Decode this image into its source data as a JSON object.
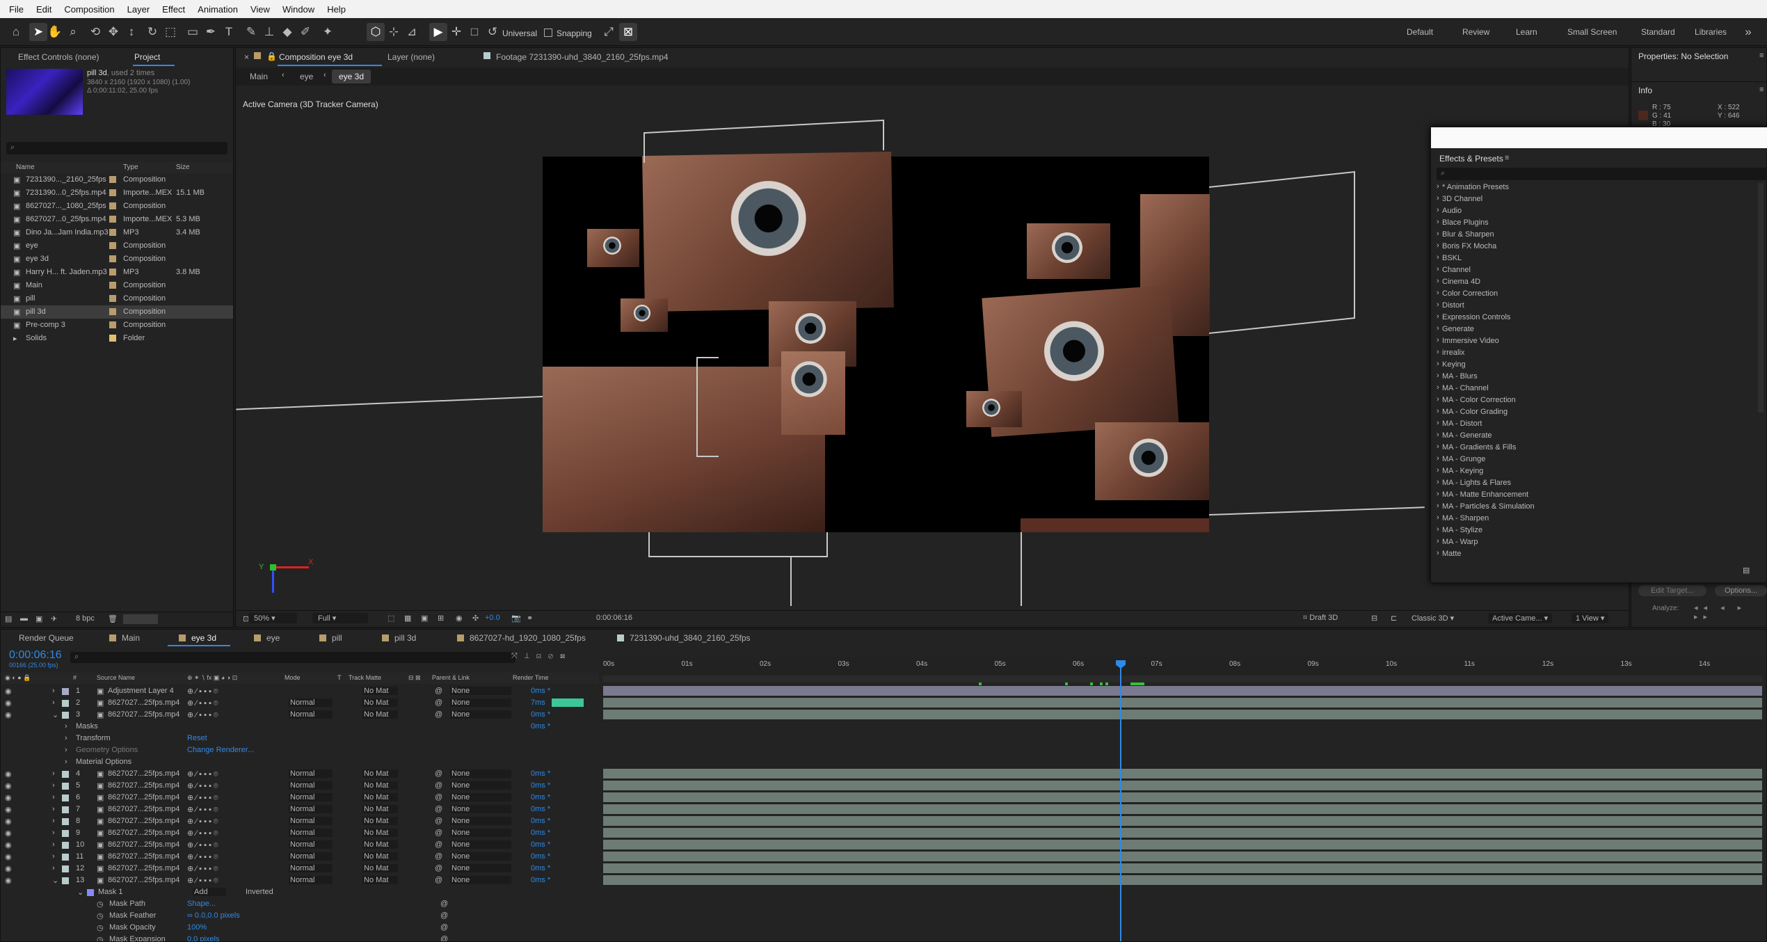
{
  "menu": [
    "File",
    "Edit",
    "Composition",
    "Layer",
    "Effect",
    "Animation",
    "View",
    "Window",
    "Help"
  ],
  "toolbar": {
    "universal": "Universal",
    "snapping": "Snapping"
  },
  "workspaces": [
    "Default",
    "Review",
    "Learn",
    "Small Screen",
    "Standard",
    "Libraries"
  ],
  "project_tabs": {
    "effect_controls": "Effect Controls (none)",
    "project": "Project"
  },
  "project_info": {
    "name": "pill 3d",
    "used": ", used 2 times",
    "dims": "3840 x 2160 (1920 x 1080) (1.00)",
    "dur": "Δ 0;00:11:02, 25.00 fps"
  },
  "project_cols": [
    "Name",
    "Type",
    "Size"
  ],
  "project_items": [
    {
      "name": "7231390..._2160_25fps",
      "type": "Composition",
      "size": "",
      "color": "#b89c6c"
    },
    {
      "name": "7231390...0_25fps.mp4",
      "type": "Importe...MEX",
      "size": "15.1 MB",
      "color": "#b89c6c"
    },
    {
      "name": "8627027..._1080_25fps",
      "type": "Composition",
      "size": "",
      "color": "#b89c6c"
    },
    {
      "name": "8627027...0_25fps.mp4",
      "type": "Importe...MEX",
      "size": "5.3 MB",
      "color": "#b89c6c"
    },
    {
      "name": "Dino Ja...Jam India.mp3",
      "type": "MP3",
      "size": "3.4 MB",
      "color": "#b89c6c"
    },
    {
      "name": "eye",
      "type": "Composition",
      "size": "",
      "color": "#b89c6c"
    },
    {
      "name": "eye 3d",
      "type": "Composition",
      "size": "",
      "color": "#b89c6c"
    },
    {
      "name": "Harry H... ft. Jaden.mp3",
      "type": "MP3",
      "size": "3.8 MB",
      "color": "#b89c6c"
    },
    {
      "name": "Main",
      "type": "Composition",
      "size": "",
      "color": "#b89c6c"
    },
    {
      "name": "pill",
      "type": "Composition",
      "size": "",
      "color": "#b89c6c"
    },
    {
      "name": "pill 3d",
      "type": "Composition",
      "size": "",
      "color": "#b89c6c"
    },
    {
      "name": "Pre-comp 3",
      "type": "Composition",
      "size": "",
      "color": "#b89c6c"
    },
    {
      "name": "Solids",
      "type": "Folder",
      "size": "",
      "color": "#e0c070"
    }
  ],
  "project_footer": {
    "bpc": "8 bpc"
  },
  "viewer_tabs": {
    "comp": "Composition eye 3d",
    "layer": "Layer (none)",
    "footage": "Footage 7231390-uhd_3840_2160_25fps.mp4"
  },
  "breadcrumbs": [
    "Main",
    "eye",
    "eye 3d"
  ],
  "viewer_label": "Active Camera (3D Tracker Camera)",
  "viewer_footer": {
    "zoom": "50%",
    "quality": "Full",
    "exposure": "+0.0",
    "timecode": "0:00:06:16",
    "draft": "Draft 3D",
    "renderer": "Classic 3D",
    "camera": "Active Came...",
    "view": "1 View"
  },
  "properties": {
    "title": "Properties: No Selection",
    "info": "Info",
    "r": "R : 75",
    "g": "G : 41",
    "b": "B : 30",
    "x": "X : 522",
    "y": "Y : 646"
  },
  "effects": {
    "title": "Effects & Presets",
    "items": [
      "* Animation Presets",
      "3D Channel",
      "Audio",
      "Blace Plugins",
      "Blur & Sharpen",
      "Boris FX Mocha",
      "BSKL",
      "Channel",
      "Cinema 4D",
      "Color Correction",
      "Distort",
      "Expression Controls",
      "Generate",
      "Immersive Video",
      "irrealix",
      "Keying",
      "MA - Blurs",
      "MA - Channel",
      "MA - Color Correction",
      "MA - Color Grading",
      "MA - Distort",
      "MA - Generate",
      "MA - Gradients & Fills",
      "MA - Grunge",
      "MA - Keying",
      "MA - Lights & Flares",
      "MA - Matte Enhancement",
      "MA - Particles & Simulation",
      "MA - Sharpen",
      "MA - Stylize",
      "MA - Warp",
      "Matte"
    ]
  },
  "tracker": {
    "edit_target": "Edit Target...",
    "options": "Options...",
    "analyze": "Analyze:"
  },
  "timeline_tabs": [
    "Render Queue",
    "Main",
    "eye 3d",
    "eye",
    "pill",
    "pill 3d",
    "8627027-hd_1920_1080_25fps",
    "7231390-uhd_3840_2160_25fps"
  ],
  "timecode": "0:00:06:16",
  "timecode_sub": "00166 (25.00 fps)",
  "tl_cols": [
    "#",
    "Source Name",
    "Mode",
    "T",
    "Track Matte",
    "Parent & Link",
    "Render Time"
  ],
  "ruler": [
    "00s",
    "01s",
    "02s",
    "03s",
    "04s",
    "05s",
    "06s",
    "07s",
    "08s",
    "09s",
    "10s",
    "11s",
    "12s",
    "13s",
    "14s"
  ],
  "layers_top": [
    {
      "n": "1",
      "name": "Adjustment Layer 4",
      "mode": "",
      "matte": "No Mat",
      "parent": "None",
      "rt": "0ms *"
    },
    {
      "n": "2",
      "name": "8627027...25fps.mp4",
      "mode": "Normal",
      "matte": "No Mat",
      "parent": "None",
      "rt": "7ms"
    },
    {
      "n": "3",
      "name": "8627027...25fps.mp4",
      "mode": "Normal",
      "matte": "No Mat",
      "parent": "None",
      "rt": "0ms *"
    }
  ],
  "layer3_props": [
    {
      "label": "Masks",
      "value": "",
      "rt": "0ms *"
    },
    {
      "label": "Transform",
      "value": "Reset",
      "rt": ""
    },
    {
      "label": "Geometry Options",
      "value": "Change Renderer...",
      "rt": ""
    },
    {
      "label": "Material Options",
      "value": "",
      "rt": ""
    }
  ],
  "layers_bottom": [
    {
      "n": "4",
      "name": "8627027...25fps.mp4",
      "mode": "Normal",
      "matte": "No Mat",
      "parent": "None",
      "rt": "0ms *"
    },
    {
      "n": "5",
      "name": "8627027...25fps.mp4",
      "mode": "Normal",
      "matte": "No Mat",
      "parent": "None",
      "rt": "0ms *"
    },
    {
      "n": "6",
      "name": "8627027...25fps.mp4",
      "mode": "Normal",
      "matte": "No Mat",
      "parent": "None",
      "rt": "0ms *"
    },
    {
      "n": "7",
      "name": "8627027...25fps.mp4",
      "mode": "Normal",
      "matte": "No Mat",
      "parent": "None",
      "rt": "0ms *"
    },
    {
      "n": "8",
      "name": "8627027...25fps.mp4",
      "mode": "Normal",
      "matte": "No Mat",
      "parent": "None",
      "rt": "0ms *"
    },
    {
      "n": "9",
      "name": "8627027...25fps.mp4",
      "mode": "Normal",
      "matte": "No Mat",
      "parent": "None",
      "rt": "0ms *"
    },
    {
      "n": "10",
      "name": "8627027...25fps.mp4",
      "mode": "Normal",
      "matte": "No Mat",
      "parent": "None",
      "rt": "0ms *"
    },
    {
      "n": "11",
      "name": "8627027...25fps.mp4",
      "mode": "Normal",
      "matte": "No Mat",
      "parent": "None",
      "rt": "0ms *"
    },
    {
      "n": "12",
      "name": "8627027...25fps.mp4",
      "mode": "Normal",
      "matte": "No Mat",
      "parent": "None",
      "rt": "0ms *"
    },
    {
      "n": "13",
      "name": "8627027...25fps.mp4",
      "mode": "Normal",
      "matte": "No Mat",
      "parent": "None",
      "rt": "0ms *"
    }
  ],
  "mask": {
    "name": "Mask 1",
    "mode": "Add",
    "inverted": "Inverted",
    "props": [
      {
        "label": "Mask Path",
        "value": "Shape..."
      },
      {
        "label": "Mask Feather",
        "value": "∞ 0.0,0.0 pixels"
      },
      {
        "label": "Mask Opacity",
        "value": "100%"
      },
      {
        "label": "Mask Expansion",
        "value": "0.0 pixels"
      }
    ]
  }
}
